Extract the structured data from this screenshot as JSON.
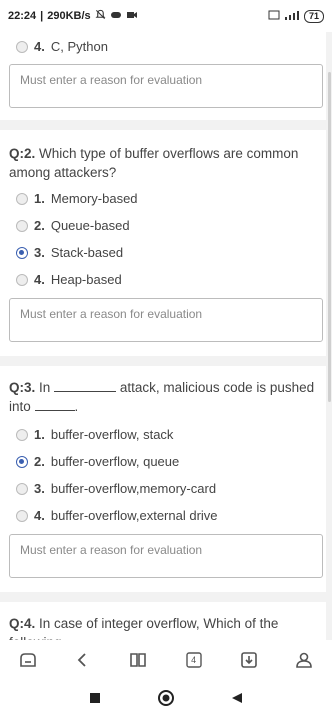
{
  "status_bar": {
    "time": "22:24",
    "net_speed": "290KB/s",
    "battery": "71"
  },
  "q1_tail": {
    "option4_num": "4.",
    "option4_text": "C, Python",
    "reason_placeholder": "Must enter a reason for evaluation"
  },
  "q2": {
    "num": "Q:2.",
    "text": "Which type of buffer overflows are common among attackers?",
    "options": [
      {
        "num": "1.",
        "text": "Memory-based",
        "selected": false
      },
      {
        "num": "2.",
        "text": "Queue-based",
        "selected": false
      },
      {
        "num": "3.",
        "text": "Stack-based",
        "selected": true
      },
      {
        "num": "4.",
        "text": "Heap-based",
        "selected": false
      }
    ],
    "reason_placeholder": "Must enter a reason for evaluation"
  },
  "q3": {
    "num": "Q:3.",
    "text_before": "In",
    "text_after": "attack, malicious code is pushed into",
    "text_end": ".",
    "options": [
      {
        "num": "1.",
        "text": "buffer-overflow, stack",
        "selected": false
      },
      {
        "num": "2.",
        "text": "buffer-overflow, queue",
        "selected": true
      },
      {
        "num": "3.",
        "text": "buffer-overflow,memory-card",
        "selected": false
      },
      {
        "num": "4.",
        "text": "buffer-overflow,external drive",
        "selected": false
      }
    ],
    "reason_placeholder": "Must enter a reason for evaluation"
  },
  "q4": {
    "num": "Q:4.",
    "text": "In case of integer overflow, Which of the following"
  },
  "bottom_nav": {
    "tab_count": "4"
  }
}
